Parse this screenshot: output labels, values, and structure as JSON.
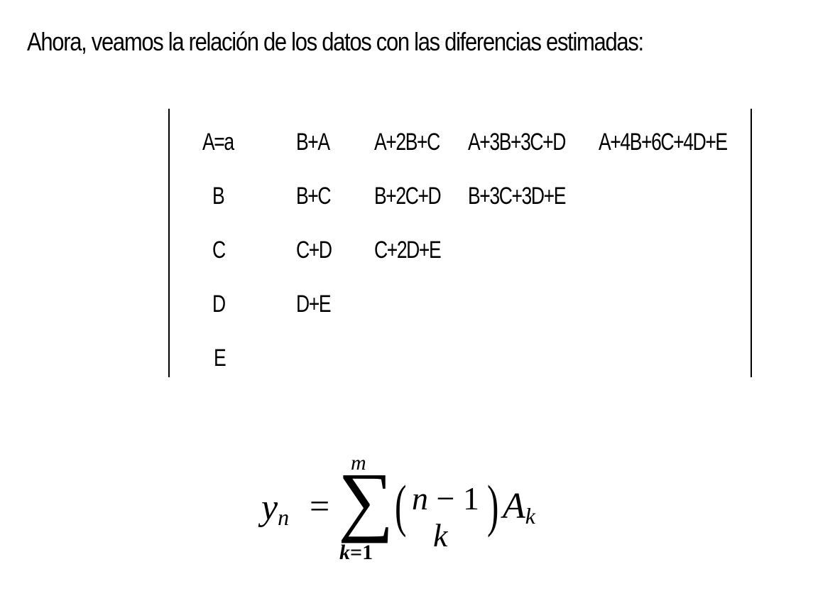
{
  "intro_text": "Ahora, veamos la relación de los datos con las diferencias estimadas:",
  "table": {
    "row1": [
      "A=a",
      "B+A",
      "A+2B+C",
      "A+3B+3C+D",
      "A+4B+6C+4D+E"
    ],
    "row2": [
      "B",
      "B+C",
      "B+2C+D",
      "B+3C+3D+E"
    ],
    "row3": [
      "C",
      "C+D",
      "C+2D+E"
    ],
    "row4": [
      "D",
      "D+E"
    ],
    "row5": [
      "E"
    ]
  },
  "formula": {
    "lhs_symbol": "y",
    "lhs_subscript": "n",
    "equals": "=",
    "sum_symbol": "∑",
    "sum_upper": "m",
    "sum_lower_var": "k",
    "sum_lower_rest": "=1",
    "paren_left": "(",
    "paren_right": ")",
    "binom_top_var": "n",
    "binom_top_rest": " − 1",
    "binom_bottom": "k",
    "term_symbol": "A",
    "term_subscript": "k"
  }
}
